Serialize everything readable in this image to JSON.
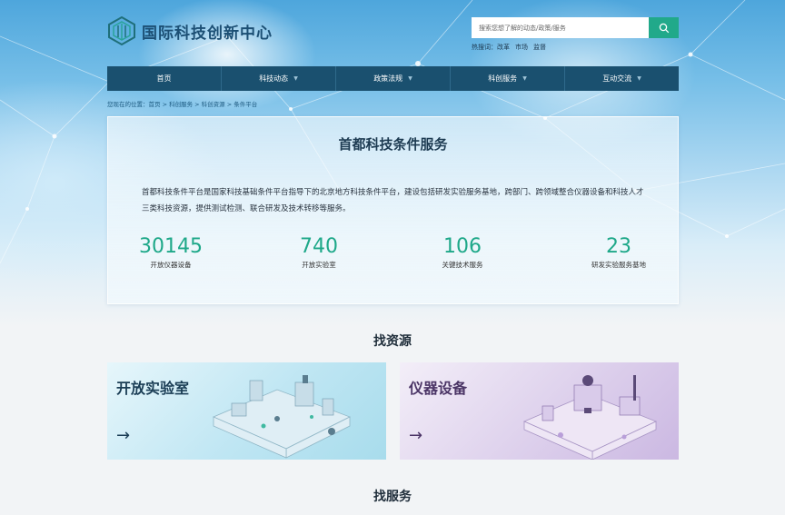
{
  "header": {
    "logo_text": "国际科技创新中心",
    "search_placeholder": "搜索您想了解的动态/政策/服务",
    "hot_label": "热搜词：",
    "hot_words": [
      "改革",
      "市场",
      "监督"
    ]
  },
  "nav": {
    "items": [
      {
        "label": "首页"
      },
      {
        "label": "科技动态"
      },
      {
        "label": "政策法规"
      },
      {
        "label": "科创服务"
      },
      {
        "label": "互动交流"
      }
    ]
  },
  "breadcrumb": "您现在的位置：首页 > 科创服务 > 科创资源 > 条件平台",
  "intro": {
    "title": "首都科技条件服务",
    "description": "首都科技条件平台是国家科技基础条件平台指导下的北京地方科技条件平台，建设包括研发实验服务基地，跨部门、跨领域整合仪器设备和科技人才三类科技资源，提供测试检测、联合研发及技术转移等服务。",
    "stats": [
      {
        "value": "30145",
        "label": "开放仪器设备"
      },
      {
        "value": "740",
        "label": "开放实验室"
      },
      {
        "value": "106",
        "label": "关键技术服务"
      },
      {
        "value": "23",
        "label": "研发实验服务基地"
      }
    ]
  },
  "find_resources": {
    "title": "找资源",
    "cards": [
      {
        "title": "开放实验室",
        "arrow": "→"
      },
      {
        "title": "仪器设备",
        "arrow": "→"
      }
    ]
  },
  "find_services": {
    "title": "找服务"
  },
  "colors": {
    "nav_bg": "#1a506f",
    "accent_green": "#1ea889",
    "search_button": "#21a98a"
  }
}
